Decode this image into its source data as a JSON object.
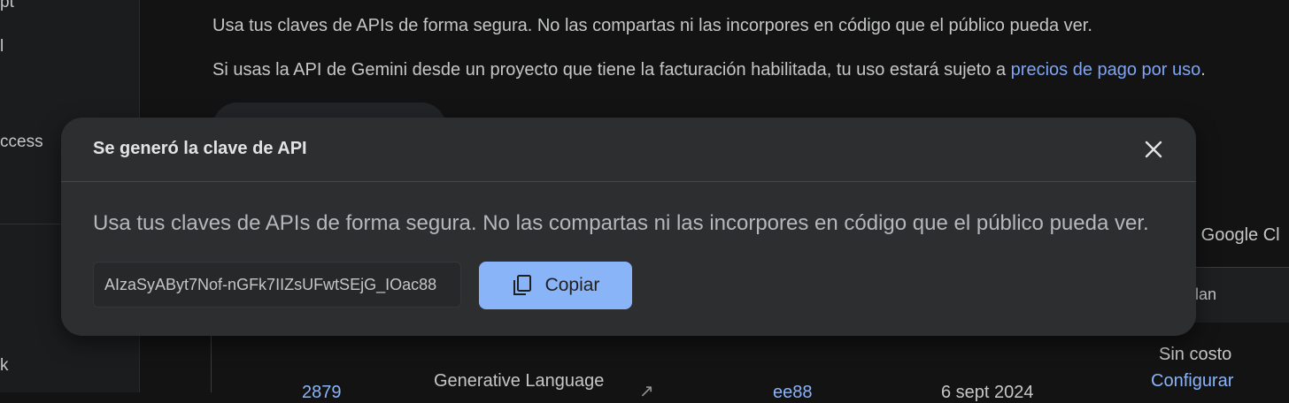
{
  "sidebar": {
    "fragments": [
      "pt",
      "l",
      "ccess",
      "k"
    ]
  },
  "main": {
    "paragraph_1": "Usa tus claves de APIs de forma segura. No las compartas ni las incorpores en código que el público pueda ver.",
    "paragraph_2_text": "Si usas la API de Gemini desde un proyecto que tiene la facturación habilitada, tu uso estará sujeto a ",
    "paragraph_2_link": "precios de pago por uso",
    "paragraph_2_end": ".",
    "right_fragment": "n Google Cl",
    "table_header_fragment": "lan",
    "row": {
      "number": "2879",
      "name": "Generative Language",
      "id_fragment": "ee88",
      "date_fragment": "6 sept 2024",
      "plan": "Sin costo",
      "plan_link": "Configurar"
    }
  },
  "dialog": {
    "title": "Se generó la clave de API",
    "message": "Usa tus claves de APIs de forma segura. No las compartas ni las incorpores en código que el público pueda ver.",
    "api_key": "AIzaSyAByt7Nof-nGFk7IIZsUFwtSEjG_IOac88",
    "copy_label": "Copiar",
    "icons": {
      "close": "close-icon",
      "copy": "copy-icon"
    },
    "accent_color": "#8ab4f8"
  }
}
